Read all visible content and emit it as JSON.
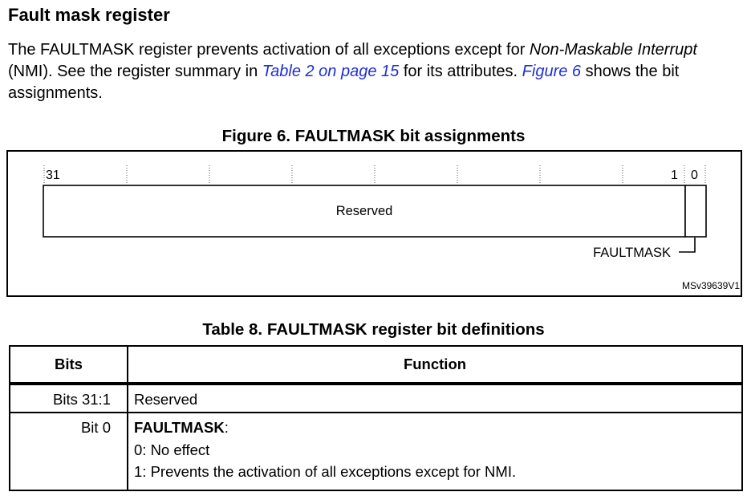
{
  "section_title": "Fault mask register",
  "intro": {
    "t1": "The FAULTMASK register prevents activation of all exceptions except for ",
    "t2": "Non-Maskable Interrupt",
    "t3": " (NMI). See the register summary in ",
    "link1": "Table 2 on page 15",
    "t4": " for its attributes. ",
    "link2": "Figure 6",
    "t5": " shows the bit assignments."
  },
  "figure": {
    "caption": "Figure 6. FAULTMASK bit assignments",
    "bit_high": "31",
    "bit_one": "1",
    "bit_zero": "0",
    "reserved_label": "Reserved",
    "faultmask_label": "FAULTMASK",
    "figure_id": "MSv39639V1"
  },
  "table": {
    "caption": "Table 8. FAULTMASK register bit definitions",
    "header_bits": "Bits",
    "header_function": "Function",
    "rows": [
      {
        "bits": "Bits 31:1",
        "function": "Reserved"
      },
      {
        "bits": "Bit 0",
        "function_name": "FAULTMASK",
        "function_suffix": ":",
        "lines": [
          "0: No effect",
          "1: Prevents the activation of all exceptions except for NMI."
        ]
      }
    ]
  }
}
